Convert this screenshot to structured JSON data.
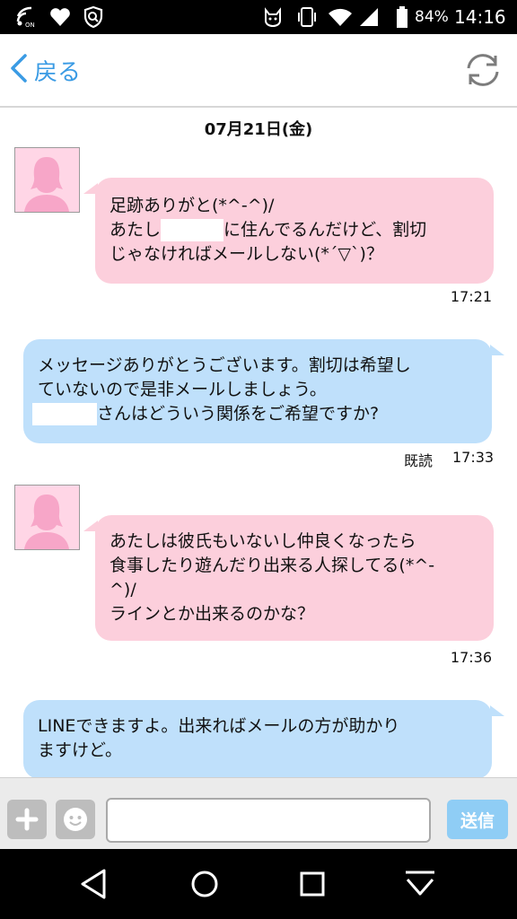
{
  "status_bar": {
    "battery_percent": "84%",
    "time": "14:16",
    "icons": [
      "nfc-on-icon",
      "heart-icon",
      "shield-icon",
      "cat-notification-icon",
      "vibrate-icon",
      "wifi-icon",
      "signal-icon",
      "battery-icon"
    ]
  },
  "header": {
    "back_label": "戻る",
    "refresh_icon": "refresh-icon"
  },
  "chat": {
    "date": "07月21日(金)",
    "messages": [
      {
        "direction": "incoming",
        "lines": [
          "足跡ありがと(*^-^)/",
          "あたし",
          "に住んでるんだけど、割切",
          "じゃなければメールしない(*´▽`)？"
        ],
        "time": "17:21"
      },
      {
        "direction": "outgoing",
        "lines": [
          "メッセージありがとうございます。割切は希望し",
          "ていないので是非メールしましょう。",
          "さんはどういう関係をご希望ですか?"
        ],
        "read_label": "既読",
        "time": "17:33"
      },
      {
        "direction": "incoming",
        "lines": [
          "あたしは彼氏もいないし仲良くなったら",
          "食事したり遊んだり出来る人探してる(*^-",
          "^)/",
          "ラインとか出来るのかな？"
        ],
        "time": "17:36"
      },
      {
        "direction": "outgoing",
        "lines": [
          "LINEできますよ。出来ればメールの方が助かり",
          "ますけど。"
        ]
      }
    ]
  },
  "input_bar": {
    "add_icon": "plus-icon",
    "emoji_icon": "smiley-icon",
    "message_value": "",
    "send_label": "送信"
  },
  "nav_bar": {
    "icons": [
      "back-triangle-icon",
      "home-circle-icon",
      "recents-square-icon",
      "notification-pulldown-icon"
    ]
  },
  "colors": {
    "accent": "#3a9be4",
    "incoming_bubble": "#fccfdc",
    "outgoing_bubble": "#bfe0fb",
    "send_button": "#8fcdf5"
  }
}
